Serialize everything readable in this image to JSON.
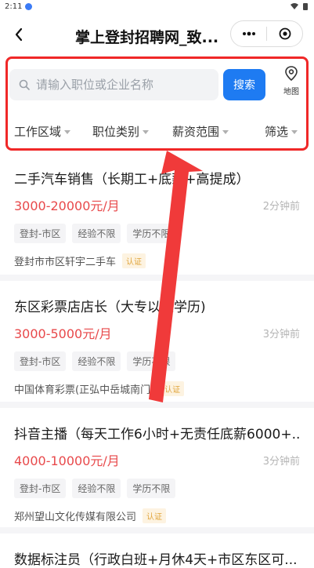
{
  "status_bar": {
    "time": "2:11"
  },
  "header": {
    "title": "掌上登封招聘网_致..."
  },
  "search": {
    "placeholder": "请输入职位或企业名称",
    "button": "搜索",
    "map_label": "地图"
  },
  "filters": [
    "工作区域",
    "职位类别",
    "薪资范围",
    "筛选"
  ],
  "jobs": [
    {
      "title": "二手汽车销售（长期工+底薪+高提成）",
      "salary": "3000-20000元/月",
      "time": "2分钟前",
      "tags": [
        "登封-市区",
        "经验不限",
        "学历不限"
      ],
      "company": "登封市市区轩宇二手车",
      "badge": "认证"
    },
    {
      "title": "东区彩票店店长（大专以上学历)",
      "salary": "3000-5000元/月",
      "time": "3分钟前",
      "tags": [
        "登封-市区",
        "经验不限",
        "学历不限"
      ],
      "company": "中国体育彩票(正弘中岳城南门)",
      "badge": "认证"
    },
    {
      "title": "抖音主播（每天工作6小时+无责任底薪6000+...",
      "salary": "4000-10000元/月",
      "time": "3分钟前",
      "tags": [
        "登封-市区",
        "经验不限",
        "学历不限"
      ],
      "company": "郑州望山文化传媒有限公司",
      "badge": "认证"
    },
    {
      "title": "数据标注员（行政白班+月休4天+市区东区可..."
    }
  ],
  "colors": {
    "accent": "#1e7bf2",
    "salary": "#e8494b",
    "highlight": "#f02828",
    "badge": "#e0a53c"
  },
  "icons": [
    "back-icon",
    "more-icon",
    "close-target-icon",
    "search-icon",
    "map-pin-icon"
  ]
}
